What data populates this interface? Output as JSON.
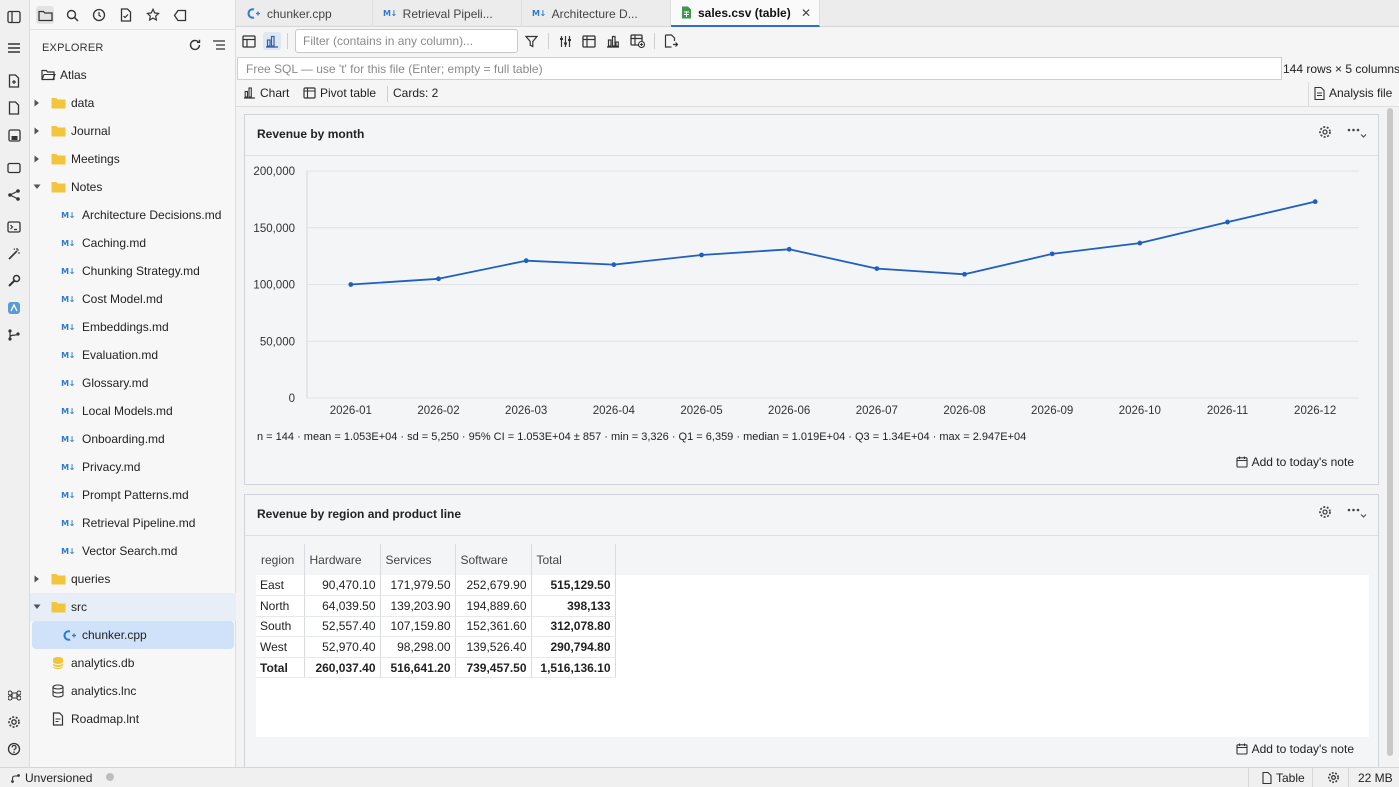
{
  "sidebar": {
    "section_label": "EXPLORER",
    "root": "Atlas",
    "folders": {
      "data": "data",
      "journal": "Journal",
      "meetings": "Meetings",
      "notes": "Notes",
      "queries": "queries",
      "src": "src"
    },
    "notes_files": [
      "Architecture Decisions.md",
      "Caching.md",
      "Chunking Strategy.md",
      "Cost Model.md",
      "Embeddings.md",
      "Evaluation.md",
      "Glossary.md",
      "Local Models.md",
      "Onboarding.md",
      "Privacy.md",
      "Prompt Patterns.md",
      "Retrieval Pipeline.md",
      "Vector Search.md"
    ],
    "src_file": "chunker.cpp",
    "root_files": [
      "analytics.db",
      "analytics.lnc",
      "Roadmap.lnt"
    ]
  },
  "tabs": [
    {
      "label": "chunker.cpp",
      "icon": "cpp-icon"
    },
    {
      "label": "Retrieval Pipeli...",
      "icon": "markdown-icon"
    },
    {
      "label": "Architecture D...",
      "icon": "markdown-icon"
    },
    {
      "label": "sales.csv (table)",
      "icon": "spreadsheet-icon",
      "active": true
    }
  ],
  "toolbar": {
    "filter_placeholder": "Filter (contains in any column)...",
    "sql_placeholder": "Free SQL — use 't' for this file (Enter; empty = full table)",
    "rows_info": "144 rows × 5 columns"
  },
  "modes": {
    "chart": "Chart",
    "pivot": "Pivot table",
    "cards": "Cards: 2",
    "analysis": "Analysis file"
  },
  "cards": {
    "line": {
      "title": "Revenue by month",
      "stats": "n = 144 · mean = 1.053E+04 · sd = 5,250 · 95% CI = 1.053E+04 ± 857 · min = 3,326 · Q1 = 6,359 · median = 1.019E+04 · Q3 = 1.34E+04 · max = 2.947E+04",
      "add_note": "Add to today's note"
    },
    "pivot": {
      "title": "Revenue by region and product line",
      "add_note": "Add to today's note",
      "columns": [
        "region",
        "Hardware",
        "Services",
        "Software",
        "Total"
      ],
      "rows": [
        [
          "East",
          "90,470.10",
          "171,979.50",
          "252,679.90",
          "515,129.50"
        ],
        [
          "North",
          "64,039.50",
          "139,203.90",
          "194,889.60",
          "398,133"
        ],
        [
          "South",
          "52,557.40",
          "107,159.80",
          "152,361.60",
          "312,078.80"
        ],
        [
          "West",
          "52,970.40",
          "98,298.00",
          "139,526.40",
          "290,794.80"
        ]
      ],
      "total_row": [
        "Total",
        "260,037.40",
        "516,641.20",
        "739,457.50",
        "1,516,136.10"
      ]
    }
  },
  "chart_data": {
    "type": "line",
    "title": "Revenue by month",
    "xlabel": "",
    "ylabel": "",
    "categories": [
      "2026-01",
      "2026-02",
      "2026-03",
      "2026-04",
      "2026-05",
      "2026-06",
      "2026-07",
      "2026-08",
      "2026-09",
      "2026-10",
      "2026-11",
      "2026-12"
    ],
    "values": [
      100000,
      105000,
      121000,
      117500,
      126000,
      131000,
      114000,
      109000,
      127000,
      136500,
      155000,
      173000
    ],
    "ylim": [
      0,
      200000
    ],
    "yticks": [
      0,
      50000,
      100000,
      150000,
      200000
    ],
    "ytick_labels": [
      "0",
      "50,000",
      "100,000",
      "150,000",
      "200,000"
    ],
    "grid": true,
    "color": "#1f5fbf"
  },
  "status": {
    "vcs": "Unversioned",
    "view": "Table",
    "memory": "22 MB"
  },
  "colors": {
    "accent": "#2f6fd1",
    "folder": "#f2c53d",
    "line": "#1f5fbf"
  }
}
